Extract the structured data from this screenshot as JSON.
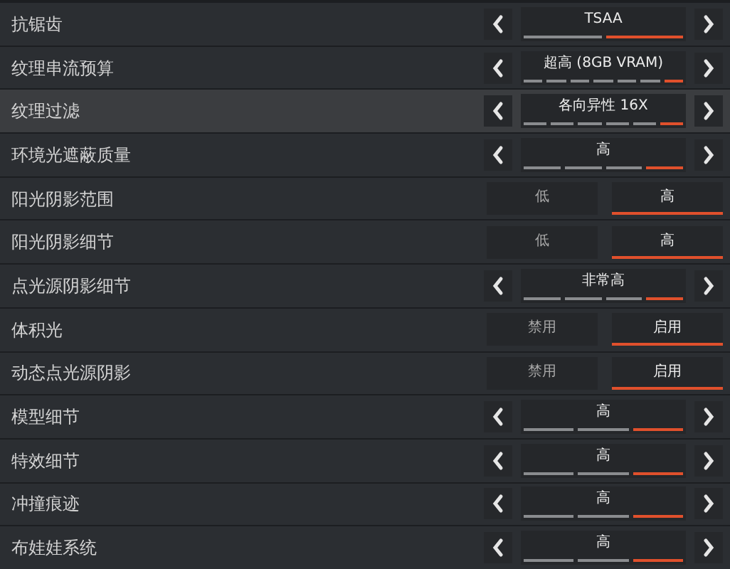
{
  "rows": [
    {
      "label": "抗锯齿",
      "highlighted": false,
      "kind": "selector",
      "value": "TSAA",
      "segments": [
        {
          "selected": false
        },
        {
          "selected": true
        }
      ]
    },
    {
      "label": "纹理串流预算",
      "highlighted": false,
      "kind": "selector",
      "value": "超高 (8GB VRAM)",
      "segments": [
        {
          "selected": false
        },
        {
          "selected": false
        },
        {
          "selected": false
        },
        {
          "selected": false
        },
        {
          "selected": false
        },
        {
          "selected": false
        },
        {
          "selected": true
        }
      ]
    },
    {
      "label": "纹理过滤",
      "highlighted": true,
      "kind": "selector",
      "value": "各向异性 16X",
      "segments": [
        {
          "selected": false
        },
        {
          "selected": false
        },
        {
          "selected": false
        },
        {
          "selected": false
        },
        {
          "selected": false
        },
        {
          "selected": true
        }
      ]
    },
    {
      "label": "环境光遮蔽质量",
      "highlighted": false,
      "kind": "selector",
      "value": "高",
      "segments": [
        {
          "selected": false
        },
        {
          "selected": false
        },
        {
          "selected": false
        },
        {
          "selected": true
        }
      ]
    },
    {
      "label": "阳光阴影范围",
      "highlighted": false,
      "kind": "toggle",
      "options": [
        {
          "label": "低",
          "selected": false
        },
        {
          "label": "高",
          "selected": true
        }
      ]
    },
    {
      "label": "阳光阴影细节",
      "highlighted": false,
      "kind": "toggle",
      "options": [
        {
          "label": "低",
          "selected": false
        },
        {
          "label": "高",
          "selected": true
        }
      ]
    },
    {
      "label": "点光源阴影细节",
      "highlighted": false,
      "kind": "selector",
      "value": "非常高",
      "segments": [
        {
          "selected": false
        },
        {
          "selected": false
        },
        {
          "selected": false
        },
        {
          "selected": true
        }
      ]
    },
    {
      "label": "体积光",
      "highlighted": false,
      "kind": "toggle",
      "options": [
        {
          "label": "禁用",
          "selected": false
        },
        {
          "label": "启用",
          "selected": true
        }
      ]
    },
    {
      "label": "动态点光源阴影",
      "highlighted": false,
      "kind": "toggle",
      "options": [
        {
          "label": "禁用",
          "selected": false
        },
        {
          "label": "启用",
          "selected": true
        }
      ]
    },
    {
      "label": "模型细节",
      "highlighted": false,
      "kind": "selector",
      "value": "高",
      "segments": [
        {
          "selected": false
        },
        {
          "selected": false
        },
        {
          "selected": true
        }
      ]
    },
    {
      "label": "特效细节",
      "highlighted": false,
      "kind": "selector",
      "value": "高",
      "segments": [
        {
          "selected": false
        },
        {
          "selected": false
        },
        {
          "selected": true
        }
      ]
    },
    {
      "label": "冲撞痕迹",
      "highlighted": false,
      "kind": "selector",
      "value": "高",
      "segments": [
        {
          "selected": false
        },
        {
          "selected": false
        },
        {
          "selected": true
        }
      ]
    },
    {
      "label": "布娃娃系统",
      "highlighted": false,
      "kind": "selector",
      "value": "高",
      "segments": [
        {
          "selected": false
        },
        {
          "selected": false
        },
        {
          "selected": true
        }
      ]
    }
  ]
}
